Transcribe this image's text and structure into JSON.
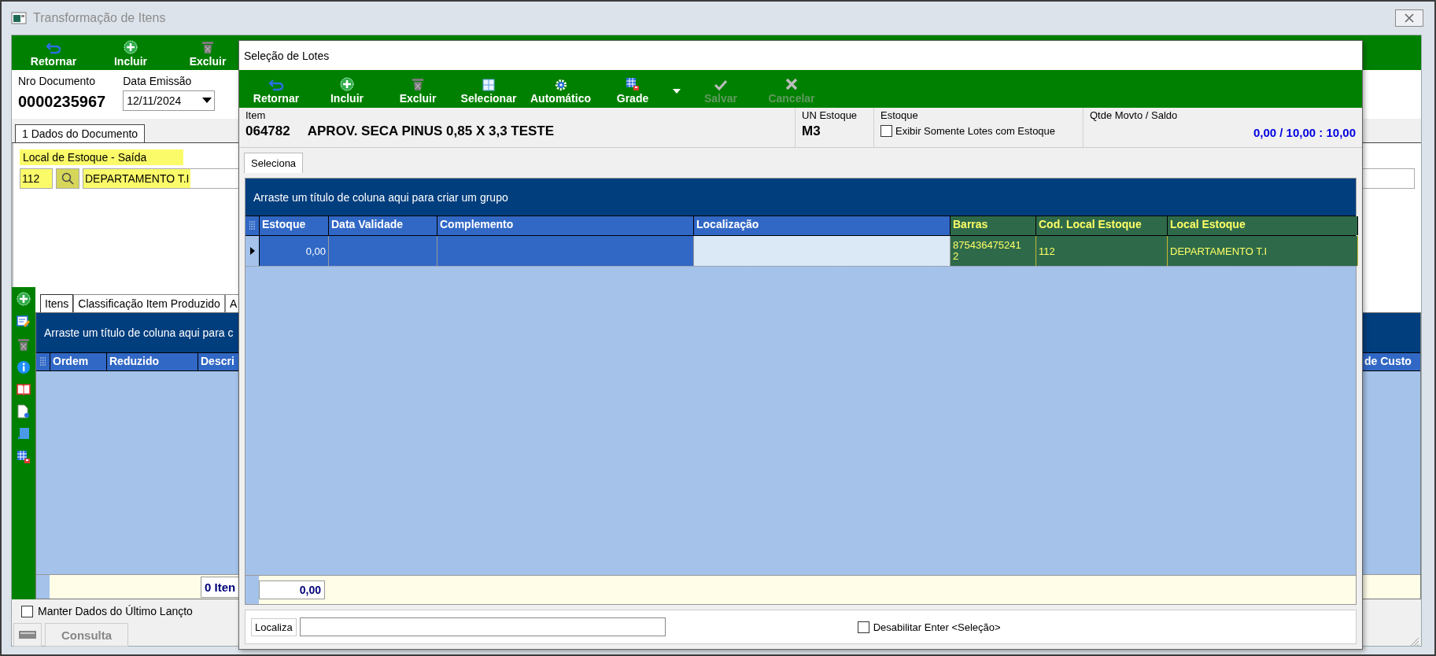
{
  "window": {
    "title": "Transformação de Itens"
  },
  "toolbar": [
    {
      "label": "Retornar",
      "disabled": false
    },
    {
      "label": "Incluir",
      "disabled": false
    },
    {
      "label": "Excluir",
      "disabled": false
    }
  ],
  "document": {
    "number_label": "Nro Documento",
    "number": "0000235967",
    "date_label": "Data Emissão",
    "date": "12/11/2024"
  },
  "tabs": [
    {
      "label": "1 Dados do Documento",
      "selected": true
    }
  ],
  "stock_location": {
    "label": "Local de Estoque - Saída",
    "code": "112",
    "name": "DEPARTAMENTO T.I",
    "highlighted": true
  },
  "item_tabs": [
    {
      "label": "Itens",
      "selected": true
    },
    {
      "label": "Classificação Item Produzido",
      "selected": false
    },
    {
      "label": "A",
      "selected": false
    }
  ],
  "items_grid": {
    "group_hint": "Arraste um título de coluna aqui para c",
    "columns": [
      "Ordem",
      "Reduzido",
      "Descri"
    ],
    "right_column": "de Custo",
    "total": "0 Iten"
  },
  "keep_last": {
    "label": "Manter Dados do Último Lançto",
    "checked": false
  },
  "status_bar": {
    "mode": "Consulta"
  },
  "dialog": {
    "title": "Seleção de Lotes",
    "toolbar": [
      {
        "label": "Retornar",
        "disabled": false
      },
      {
        "label": "Incluir",
        "disabled": false
      },
      {
        "label": "Excluir",
        "disabled": false
      },
      {
        "label": "Selecionar",
        "disabled": false
      },
      {
        "label": "Automático",
        "disabled": false
      },
      {
        "label": "Grade",
        "disabled": false,
        "dropdown": true
      },
      {
        "label": "Salvar",
        "disabled": true
      },
      {
        "label": "Cancelar",
        "disabled": true
      }
    ],
    "item": {
      "label": "Item",
      "code": "064782",
      "description": "APROV. SECA PINUS 0,85 X 3,3 TESTE"
    },
    "unit": {
      "label": "UN Estoque",
      "value": "M3"
    },
    "stock": {
      "label": "Estoque",
      "option": "Exibir Somente Lotes com Estoque",
      "checked": false
    },
    "balance": {
      "label": "Qtde Movto / Saldo",
      "value": "0,00 / 10,00 : 10,00"
    },
    "tabs": [
      {
        "label": "Seleciona",
        "selected": true
      }
    ],
    "grid": {
      "group_hint": "Arraste um título de coluna aqui para criar um grupo",
      "columns": [
        {
          "label": "Estoque",
          "kind": "normal"
        },
        {
          "label": "Data Validade",
          "kind": "normal"
        },
        {
          "label": "Complemento",
          "kind": "normal"
        },
        {
          "label": "Localização",
          "kind": "normal"
        },
        {
          "label": "Barras",
          "kind": "highlight"
        },
        {
          "label": "Cod. Local Estoque",
          "kind": "highlight"
        },
        {
          "label": "Local Estoque",
          "kind": "highlight"
        }
      ],
      "rows": [
        {
          "selected": true,
          "cells": [
            {
              "text": "0,00",
              "focused": false
            },
            {
              "focused": false
            },
            {
              "focused": false
            },
            {
              "focused": true
            },
            {
              "text": "8754364752412",
              "focused": false
            },
            {
              "text": "112",
              "focused": false
            },
            {
              "text": "DEPARTAMENTO T.I",
              "focused": false
            }
          ]
        }
      ],
      "total": "0,00"
    },
    "search": {
      "label": "Localiza"
    },
    "disable_enter": {
      "label": "Desabilitar Enter <Seleção>",
      "checked": false
    }
  }
}
